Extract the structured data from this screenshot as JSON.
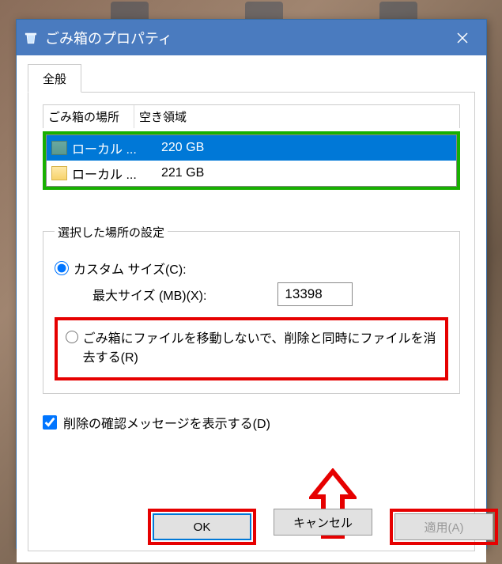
{
  "dialog": {
    "title": "ごみ箱のプロパティ"
  },
  "tabs": {
    "general": "全般"
  },
  "listview": {
    "headers": {
      "location": "ごみ箱の場所",
      "free": "空き領域"
    },
    "rows": [
      {
        "name": "ローカル ...",
        "free": "220 GB",
        "selected": true,
        "iconType": "teal"
      },
      {
        "name": "ローカル ...",
        "free": "221 GB",
        "selected": false,
        "iconType": "yellow"
      }
    ]
  },
  "settings": {
    "legend": "選択した場所の設定",
    "customSize": {
      "label": "カスタム サイズ(C):",
      "maxSizeLabel": "最大サイズ (MB)(X):",
      "value": "13398"
    },
    "noRecycle": {
      "label": "ごみ箱にファイルを移動しないで、削除と同時にファイルを消去する(R)"
    },
    "confirmDelete": {
      "label": "削除の確認メッセージを表示する(D)"
    }
  },
  "buttons": {
    "ok": "OK",
    "cancel": "キャンセル",
    "apply": "適用(A)"
  }
}
